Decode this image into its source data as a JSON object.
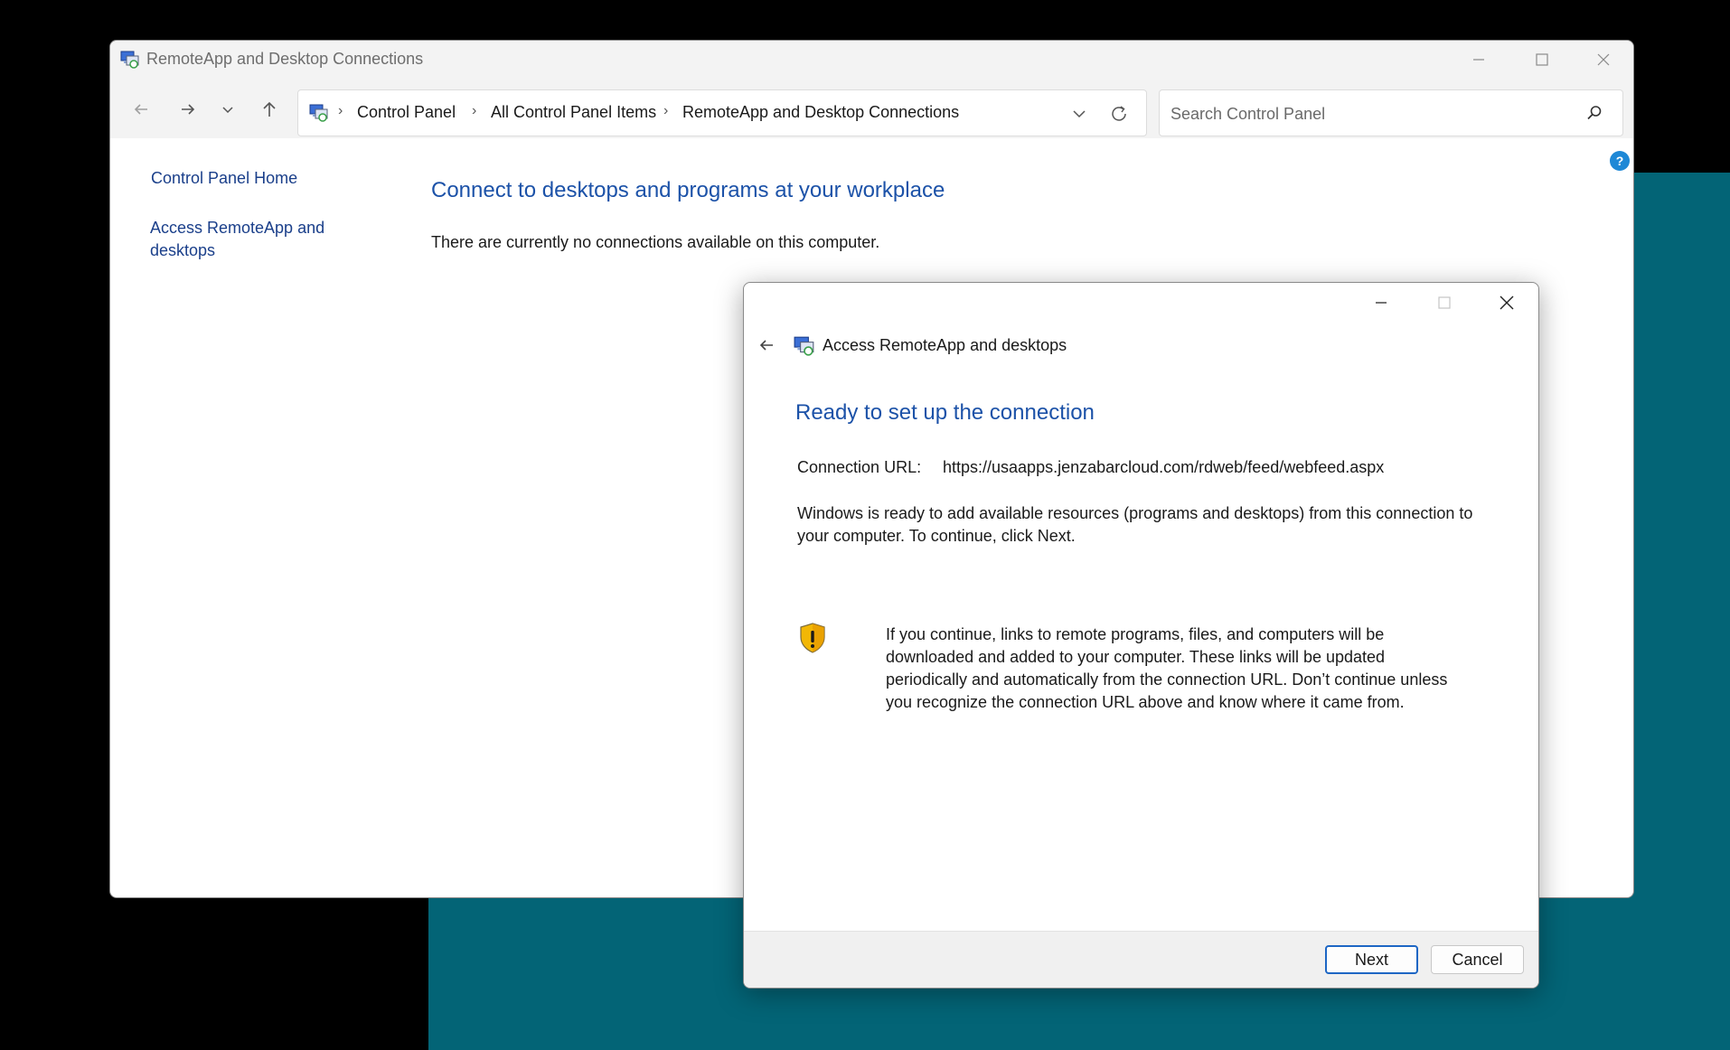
{
  "main_window": {
    "title": "RemoteApp and Desktop Connections",
    "breadcrumb": [
      "Control Panel",
      "All Control Panel Items",
      "RemoteApp and Desktop Connections"
    ],
    "search_placeholder": "Search Control Panel",
    "help_label": "?",
    "sidebar": {
      "home_link": "Control Panel Home",
      "access_link_line1": "Access RemoteApp and",
      "access_link_line2": "desktops"
    },
    "heading": "Connect to desktops and programs at your workplace",
    "status_text": "There are currently no connections available on this computer."
  },
  "dialog": {
    "title": "Access RemoteApp and desktops",
    "heading": "Ready to set up the connection",
    "url_label": "Connection URL:",
    "url_value": "https://usaapps.jenzabarcloud.com/rdweb/feed/webfeed.aspx",
    "info_text": "Windows is ready to add available resources (programs and desktops) from this connection to your computer. To continue, click Next.",
    "warning_text": "If you continue, links to remote programs, files, and computers will be downloaded and added to your computer.  These links will be updated periodically and automatically from the connection URL. Don’t continue unless you recognize the connection URL above and know where it came from.",
    "next_label": "Next",
    "cancel_label": "Cancel"
  },
  "colors": {
    "accent_link": "#1c52a8",
    "background_teal": "#036476",
    "primary_button_border": "#1d66c4"
  },
  "icons": [
    "app-icon",
    "minimize-icon",
    "maximize-icon",
    "close-icon",
    "back-arrow-icon",
    "forward-arrow-icon",
    "recent-dropdown-icon",
    "up-arrow-icon",
    "chevron-down-icon",
    "refresh-icon",
    "search-icon",
    "help-icon",
    "shield-warning-icon"
  ]
}
